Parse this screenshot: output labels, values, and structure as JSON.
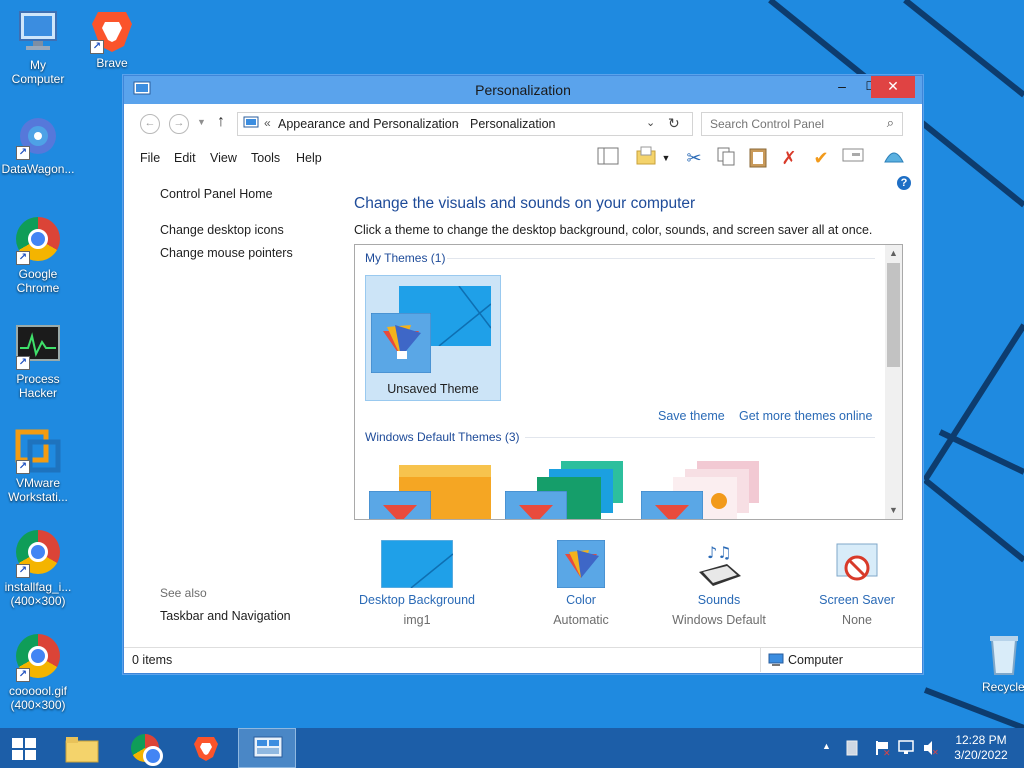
{
  "desktop": {
    "icons": [
      {
        "label": "My\nComputer"
      },
      {
        "label": "Brave"
      },
      {
        "label": "DataWagon..."
      },
      {
        "label": "Google\nChrome"
      },
      {
        "label": "Process\nHacker"
      },
      {
        "label": "VMware\nWorkstati..."
      },
      {
        "label": "installfag_i...\n(400×300)"
      },
      {
        "label": "coooool.gif\n(400×300)"
      },
      {
        "label": "Recycle"
      }
    ]
  },
  "window": {
    "title": "Personalization",
    "controls": {
      "minimize": "–",
      "maximize": "☐",
      "close": "✕"
    },
    "address": {
      "chevron": "«",
      "crumb1": "Appearance and Personalization",
      "sep": "›",
      "crumb2": "Personalization"
    },
    "search": {
      "placeholder": "Search Control Panel"
    },
    "menu": {
      "file": "File",
      "edit": "Edit",
      "view": "View",
      "tools": "Tools",
      "help": "Help"
    },
    "left_pane": {
      "home": "Control Panel Home",
      "desktop_icons": "Change desktop icons",
      "mouse_pointers": "Change mouse pointers",
      "see_also": "See also",
      "taskbar_nav": "Taskbar and Navigation"
    },
    "main": {
      "heading": "Change the visuals and sounds on your computer",
      "instruction": "Click a theme to change the desktop background, color, sounds, and screen saver all at once.",
      "my_themes": "My Themes (1)",
      "unsaved_theme": "Unsaved Theme",
      "save_theme": "Save theme",
      "get_more": "Get more themes online",
      "default_themes": "Windows Default Themes (3)"
    },
    "bottom": {
      "background": {
        "label": "Desktop Background",
        "value": "img1"
      },
      "color": {
        "label": "Color",
        "value": "Automatic"
      },
      "sounds": {
        "label": "Sounds",
        "value": "Windows Default"
      },
      "saver": {
        "label": "Screen Saver",
        "value": "None"
      }
    },
    "status": {
      "items": "0 items",
      "location": "Computer"
    }
  },
  "taskbar": {
    "time": "12:28 PM",
    "date": "3/20/2022"
  },
  "colors": {
    "desktop": "#1f8ae0",
    "titlebar": "#5aa3ec",
    "close": "#e04343",
    "taskbar": "#1c5ea8",
    "link": "#2a6ab6"
  }
}
